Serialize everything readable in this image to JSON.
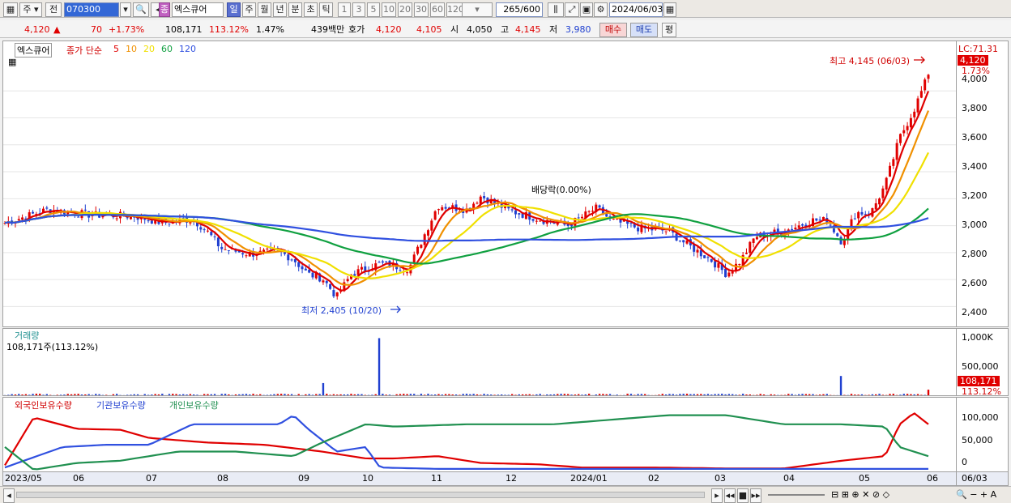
{
  "toolbar": {
    "type_label": "주",
    "prev_label": "전",
    "code_value": "070300",
    "badge": "종",
    "stock_name": "엑스큐어",
    "periods": [
      "일",
      "주",
      "월",
      "년",
      "분",
      "초",
      "틱"
    ],
    "period_active": "일",
    "intervals": [
      "1",
      "3",
      "5",
      "10",
      "20",
      "30",
      "60",
      "120"
    ],
    "count": "265",
    "count_max": "/600",
    "date": "2024/06/03"
  },
  "quote": {
    "price": "4,120",
    "arrow": "▲",
    "change": "70",
    "change_pct": "+1.73%",
    "volume": "108,171",
    "vol_ratio": "113.12%",
    "turnover": "1.47%",
    "amount": "439백만",
    "ask_label": "호가",
    "ask1": "4,120",
    "ask2": "4,105",
    "open_label": "시",
    "open": "4,050",
    "high_label": "고",
    "high": "4,145",
    "low_label": "저",
    "low": "3,980",
    "buy_label": "매수",
    "sell_label": "매도",
    "eval_label": "평"
  },
  "price_panel": {
    "name_tag": "엑스큐어",
    "legend_prefix": "종가 단순",
    "ma_labels": [
      "5",
      "10",
      "20",
      "60",
      "120"
    ],
    "ma_colors": [
      "#e00000",
      "#f09000",
      "#f0e000",
      "#10a040",
      "#3050e0"
    ],
    "lc_label": "LC:71.31",
    "last_price": "4,120",
    "last_pct": "1.73%",
    "high_note": "최고 4,145 (06/03)",
    "low_note": "최저 2,405 (10/20)",
    "dividend_note": "배당락(0.00%)",
    "y_ticks": [
      "4,000",
      "3,800",
      "3,600",
      "3,400",
      "3,200",
      "3,000",
      "2,800",
      "2,600",
      "2,400"
    ]
  },
  "volume_panel": {
    "title": "거래량",
    "summary": "108,171주(113.12%)",
    "y_ticks": [
      "1,000K",
      "500,000"
    ],
    "last_value": "108,171",
    "last_pct": "113.12%"
  },
  "holding_panel": {
    "legend": [
      "외국인보유수량",
      "기관보유수량",
      "개인보유수량"
    ],
    "colors": [
      "#e00000",
      "#3050e0",
      "#209050"
    ],
    "y_ticks": [
      "100,000",
      "50,000",
      "0"
    ]
  },
  "x_axis": {
    "labels": [
      "2023/05",
      "06",
      "07",
      "08",
      "09",
      "10",
      "11",
      "12",
      "2024/01",
      "02",
      "03",
      "04",
      "05",
      "06"
    ],
    "right_label": "06/03"
  },
  "chart_data": {
    "type": "candlestick",
    "x_range": [
      "2023/05",
      "2024/06/03"
    ],
    "price_ylim": [
      2300,
      4200
    ],
    "price_path": [
      [
        0,
        3020
      ],
      [
        3,
        3120
      ],
      [
        6,
        3080
      ],
      [
        9,
        3070
      ],
      [
        11,
        3020
      ],
      [
        13,
        3050
      ],
      [
        14,
        2960
      ],
      [
        15,
        2830
      ],
      [
        17,
        2790
      ],
      [
        19,
        2810
      ],
      [
        20,
        2750
      ],
      [
        21,
        2640
      ],
      [
        22,
        2610
      ],
      [
        23,
        2470
      ],
      [
        24,
        2640
      ],
      [
        26,
        2720
      ],
      [
        28,
        2680
      ],
      [
        30,
        3150
      ],
      [
        32,
        3120
      ],
      [
        33,
        3220
      ],
      [
        35,
        3110
      ],
      [
        37,
        3050
      ],
      [
        39,
        3000
      ],
      [
        41,
        3130
      ],
      [
        42,
        3040
      ],
      [
        44,
        2980
      ],
      [
        46,
        2960
      ],
      [
        47,
        2880
      ],
      [
        49,
        2740
      ],
      [
        50,
        2640
      ],
      [
        51,
        2740
      ],
      [
        52,
        2920
      ],
      [
        54,
        2960
      ],
      [
        56,
        3040
      ],
      [
        57,
        3040
      ],
      [
        58,
        2880
      ],
      [
        59,
        3100
      ],
      [
        60,
        3090
      ],
      [
        61,
        3300
      ],
      [
        62,
        3650
      ],
      [
        63,
        3860
      ],
      [
        64,
        4120
      ]
    ],
    "high": 4145,
    "high_date": "06/03",
    "low": 2405,
    "low_date": "10/20",
    "volume_ylim": [
      0,
      1000000
    ],
    "volume_spikes": [
      [
        26,
        980000
      ],
      [
        22,
        220000
      ],
      [
        58,
        340000
      ],
      [
        64,
        108171
      ]
    ],
    "holding_ylim": [
      0,
      130000
    ],
    "series": [
      {
        "name": "외국인보유수량",
        "values": [
          [
            0,
            10000
          ],
          [
            2,
            115000
          ],
          [
            5,
            90000
          ],
          [
            8,
            88000
          ],
          [
            10,
            70000
          ],
          [
            14,
            60000
          ],
          [
            18,
            55000
          ],
          [
            22,
            40000
          ],
          [
            25,
            25000
          ],
          [
            27,
            25000
          ],
          [
            30,
            30000
          ],
          [
            33,
            15000
          ],
          [
            37,
            12000
          ],
          [
            40,
            5000
          ],
          [
            45,
            5000
          ],
          [
            50,
            3000
          ],
          [
            54,
            3000
          ],
          [
            58,
            20000
          ],
          [
            61,
            30000
          ],
          [
            62,
            100000
          ],
          [
            63,
            125000
          ],
          [
            64,
            100000
          ]
        ]
      },
      {
        "name": "기관보유수량",
        "values": [
          [
            0,
            5000
          ],
          [
            4,
            50000
          ],
          [
            7,
            55000
          ],
          [
            10,
            55000
          ],
          [
            13,
            100000
          ],
          [
            15,
            100000
          ],
          [
            17,
            100000
          ],
          [
            19,
            100000
          ],
          [
            20,
            120000
          ],
          [
            21,
            90000
          ],
          [
            23,
            40000
          ],
          [
            25,
            50000
          ],
          [
            26,
            5000
          ],
          [
            30,
            2000
          ],
          [
            40,
            2000
          ],
          [
            50,
            2000
          ],
          [
            64,
            2000
          ]
        ]
      },
      {
        "name": "개인보유수량",
        "values": [
          [
            0,
            50000
          ],
          [
            2,
            0
          ],
          [
            5,
            15000
          ],
          [
            8,
            20000
          ],
          [
            12,
            40000
          ],
          [
            16,
            40000
          ],
          [
            20,
            30000
          ],
          [
            22,
            60000
          ],
          [
            25,
            100000
          ],
          [
            27,
            95000
          ],
          [
            32,
            100000
          ],
          [
            38,
            100000
          ],
          [
            42,
            110000
          ],
          [
            46,
            120000
          ],
          [
            50,
            120000
          ],
          [
            54,
            100000
          ],
          [
            58,
            100000
          ],
          [
            61,
            95000
          ],
          [
            62,
            50000
          ],
          [
            63,
            40000
          ],
          [
            64,
            30000
          ]
        ]
      }
    ]
  }
}
